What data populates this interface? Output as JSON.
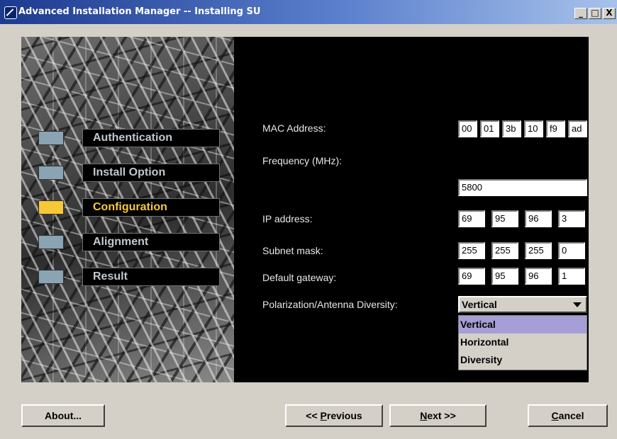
{
  "window": {
    "title": "Advanced Installation Manager -- Installing SU",
    "controls": {
      "minimize": "_",
      "maximize": "□",
      "close": "X"
    }
  },
  "steps": [
    {
      "label": "Authentication",
      "active": false
    },
    {
      "label": "Install Option",
      "active": false
    },
    {
      "label": "Configuration",
      "active": true
    },
    {
      "label": "Alignment",
      "active": false
    },
    {
      "label": "Result",
      "active": false
    }
  ],
  "form": {
    "mac_label": "MAC Address:",
    "mac": [
      "00",
      "01",
      "3b",
      "10",
      "f9",
      "ad"
    ],
    "frequency_label": "Frequency (MHz):",
    "frequency": "5800",
    "ip_label": "IP address:",
    "ip": [
      "69",
      "95",
      "96",
      "3"
    ],
    "subnet_label": "Subnet mask:",
    "subnet": [
      "255",
      "255",
      "255",
      "0"
    ],
    "gateway_label": "Default gateway:",
    "gateway": [
      "69",
      "95",
      "96",
      "1"
    ],
    "polarization_label": "Polarization/Antenna Diversity:",
    "polarization_selected": "Vertical",
    "polarization_options": [
      "Vertical",
      "Horizontal",
      "Diversity"
    ]
  },
  "buttons": {
    "about": "About...",
    "previous_prefix": "<< ",
    "previous_mnemonic": "P",
    "previous_rest": "revious",
    "next_mnemonic": "N",
    "next_rest": "ext >>",
    "cancel_mnemonic": "C",
    "cancel_rest": "ancel"
  },
  "colors": {
    "title_bar_start": "#1c3a8e",
    "active_step": "#f7c838",
    "inactive_step": "#8aa4b4",
    "selection": "#a69ed6"
  }
}
